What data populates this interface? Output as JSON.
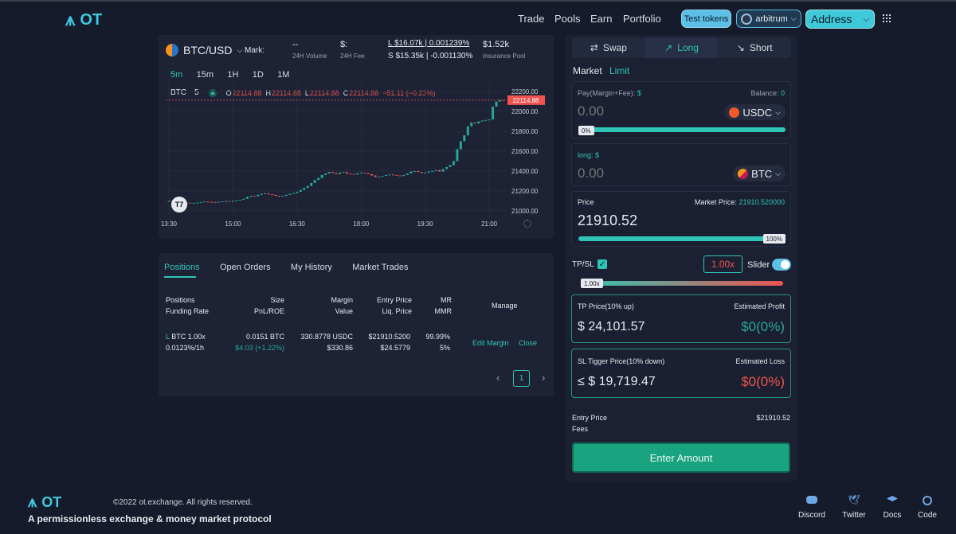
{
  "brand": {
    "name": "OT",
    "glyph": "⩚"
  },
  "nav": {
    "items": [
      "Trade",
      "Pools",
      "Earn",
      "Portfolio"
    ]
  },
  "header": {
    "test_tokens": "Test tokens",
    "network": "arbitrum",
    "address": "Address",
    "apps_icon": "grid-icon"
  },
  "market": {
    "pair": "BTC/USD",
    "mark_label": "Mark:",
    "vol_value": "--",
    "vol_label": "24H Volume",
    "fee_value": "$:",
    "fee_label": "24H Fee",
    "long_line": "L $16.07k | 0.001239%",
    "short_line": "S $15.35k | -0.001130%",
    "insurance_value": "$1.52k",
    "insurance_label": "Insurance Pool"
  },
  "chart": {
    "timeframes": [
      "5m",
      "15m",
      "1H",
      "1D",
      "1M"
    ],
    "active_tf": "5m",
    "symbol": "BTC",
    "interval": "5",
    "o_label": "O",
    "o": "22114.88",
    "h_label": "H",
    "h": "22114.88",
    "l_label": "L",
    "l": "22114.88",
    "c_label": "C",
    "c": "22114.88",
    "change": "−51.11 (−0.23%)",
    "last_price": "22114.88",
    "tv_logo": "T7"
  },
  "chart_data": {
    "type": "candlestick",
    "y_ticks": [
      22200.0,
      22000.0,
      21800.0,
      21600.0,
      21400.0,
      21200.0,
      21000.0
    ],
    "y_tick_labels": [
      "22200.00",
      "22000.00",
      "21800.00",
      "21600.00",
      "21400.00",
      "21200.00",
      "21000.00"
    ],
    "ylim": [
      20990,
      22210
    ],
    "x_labels": [
      "13:30",
      "15:00",
      "16:30",
      "18:00",
      "19:30",
      "21:00"
    ],
    "x_label_pos": [
      0,
      18,
      36,
      54,
      72,
      90
    ],
    "x_count": 95,
    "last_price": 22114.88,
    "close": [
      21100,
      21095,
      21090,
      21085,
      21080,
      21080,
      21075,
      21078,
      21082,
      21088,
      21092,
      21090,
      21088,
      21086,
      21090,
      21094,
      21098,
      21096,
      21100,
      21104,
      21110,
      21120,
      21140,
      21150,
      21145,
      21160,
      21170,
      21175,
      21165,
      21160,
      21150,
      21145,
      21150,
      21160,
      21170,
      21178,
      21190,
      21210,
      21230,
      21250,
      21280,
      21310,
      21330,
      21360,
      21375,
      21390,
      21380,
      21370,
      21385,
      21390,
      21375,
      21370,
      21365,
      21378,
      21385,
      21380,
      21370,
      21355,
      21340,
      21345,
      21350,
      21360,
      21365,
      21360,
      21355,
      21350,
      21360,
      21375,
      21395,
      21400,
      21390,
      21380,
      21385,
      21395,
      21400,
      21410,
      21395,
      21420,
      21440,
      21460,
      21500,
      21620,
      21700,
      21760,
      21850,
      21890,
      21880,
      21900,
      21910,
      21915,
      21920,
      22050,
      22100,
      22115,
      22114.88
    ]
  },
  "positions": {
    "tabs": [
      "Positions",
      "Open Orders",
      "My History",
      "Market Trades"
    ],
    "active_tab": "Positions",
    "headers": [
      [
        "Positions",
        "Funding Rate"
      ],
      [
        "Size",
        "PnL/ROE"
      ],
      [
        "Margin",
        "Value"
      ],
      [
        "Entry Price",
        "Liq. Price"
      ],
      [
        "MR",
        "MMR"
      ],
      [
        "Manage"
      ]
    ],
    "row": {
      "side": "L",
      "pos": "BTC 1.00x",
      "funding": "0.0123%/1h",
      "size": "0.0151 BTC",
      "pnl": "$4.03 (+1.22%)",
      "margin": "330.8778 USDC",
      "value": "$330.86",
      "entry": "$21910.5200",
      "liq": "$24.5779",
      "mr": "99.99%",
      "mmr": "5%",
      "edit": "Edit Margin",
      "close": "Close"
    },
    "pager": {
      "prev": "‹",
      "page": "1",
      "next": "›"
    }
  },
  "trade": {
    "modes": [
      "Swap",
      "Long",
      "Short"
    ],
    "active_mode": "Long",
    "order_types": [
      "Market",
      "Limit"
    ],
    "active_type": "Market",
    "pay_label": "Pay(Margin+Fee):",
    "pay_unit": "$",
    "balance_label": "Balance:",
    "balance_value": "0",
    "pay_amount": "0.00",
    "pay_token": "USDC",
    "pay_pct": "0%",
    "pay_fill": 0,
    "long_label": "long:",
    "long_unit": "$",
    "long_amount": "0.00",
    "long_token": "BTC",
    "price_label": "Price",
    "market_price_label": "Market Price:",
    "market_price": "21910.520000",
    "price_value": "21910.52",
    "price_pct": "100%",
    "price_fill": 1,
    "tpsl_label": "TP/SL",
    "leverage": "1.00x",
    "slider_label": "Slider",
    "lev_tag": "1.00x",
    "tp_label": "TP Price(10% up)",
    "est_profit_label": "Estimated Profit",
    "tp_value": "$ 24,101.57",
    "tp_profit": "$0(0%)",
    "sl_label": "SL Tigger Price(10% down)",
    "est_loss_label": "Estimated Loss",
    "sl_value": "≤ $ 19,719.47",
    "sl_loss": "$0(0%)",
    "entry_label": "Entry Price",
    "entry_value": "$21910.52",
    "fees_label": "Fees",
    "submit": "Enter Amount"
  },
  "footer": {
    "copyright": "©2022 ot.exchange. All rights reserved.",
    "tagline": "A permissionless exchange & money market protocol",
    "links": [
      "Discord",
      "Twitter",
      "Docs",
      "Code"
    ]
  },
  "colors": {
    "accent": "#2ec4b6",
    "up": "#26a69a",
    "down": "#ef5350",
    "bg": "#161b2b",
    "card": "#1d2335"
  }
}
